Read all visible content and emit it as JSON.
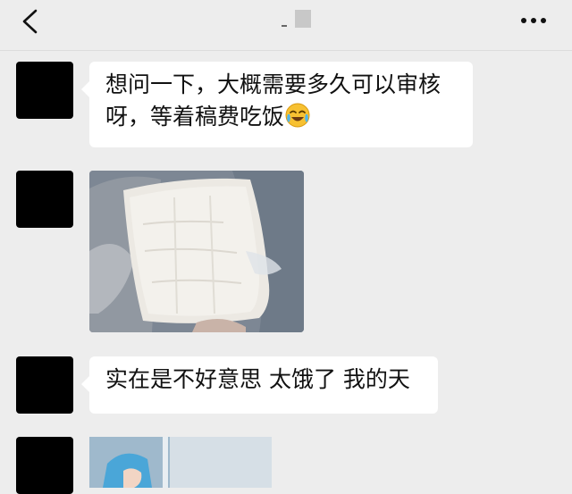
{
  "header": {
    "title": "",
    "back_icon": "chevron-left-icon",
    "more_icon": "more-horizontal-icon"
  },
  "messages": [
    {
      "type": "text",
      "text_line1": "想问一下，大概需要多久可以审核",
      "text_line2": "呀，等着稿费吃饭",
      "emoji": "crying-laughing-emoji"
    },
    {
      "type": "image",
      "description_icon": "photo-tofu-icon"
    },
    {
      "type": "text",
      "text": "实在是不好意思 太饿了 我的天"
    },
    {
      "type": "image",
      "description_icon": "photo-person-icon"
    }
  ],
  "colors": {
    "background": "#ededed",
    "bubble": "#ffffff",
    "avatar": "#000000"
  }
}
